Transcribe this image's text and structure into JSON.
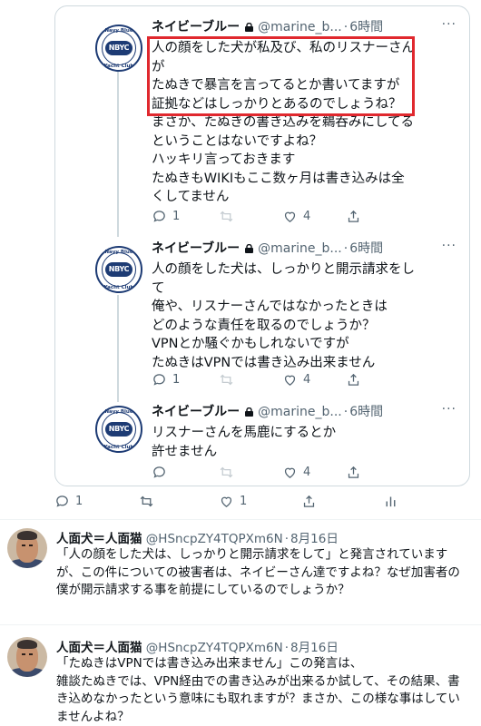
{
  "quoted_tweets": [
    {
      "display_name": "ネイビーブルー",
      "handle": "@marine_b...",
      "time": "6時間",
      "logo": {
        "top_text": "Navy Blue",
        "center_text": "NBYC",
        "bottom_text": "Yacht Club"
      },
      "lines": [
        "人の顔をした犬が私及び、私のリスナーさん",
        "が",
        "たぬきで暴言を言ってるとか書いてますが",
        "証拠などはしっかりとあるのでしょうね？",
        "まさか、たぬきの書き込みを鵜呑みにしてる",
        "ということはないですよね？",
        "ハッキリ言っておきます",
        "たぬきもWIKIもここ数ヶ月は書き込みは全",
        "くしてません"
      ],
      "reply_count": "1",
      "like_count": "4"
    },
    {
      "display_name": "ネイビーブルー",
      "handle": "@marine_b...",
      "time": "6時間",
      "logo": {
        "top_text": "Navy Blue",
        "center_text": "NBYC",
        "bottom_text": "Yacht Club"
      },
      "lines": [
        "人の顔をした犬は、しっかりと開示請求をし",
        "て",
        "俺や、リスナーさんではなかったときは",
        "どのような責任を取るのでしょうか？",
        "VPNとか騒ぐかもしれないですが",
        "たぬきはVPNでは書き込み出来ません"
      ],
      "reply_count": "1",
      "like_count": "4"
    },
    {
      "display_name": "ネイビーブルー",
      "handle": "@marine_b...",
      "time": "6時間",
      "logo": {
        "top_text": "Navy Blue",
        "center_text": "NBYC",
        "bottom_text": "Yacht Club"
      },
      "lines": [
        "リスナーさんを馬鹿にするとか",
        "許せません"
      ],
      "reply_count": "",
      "like_count": "4"
    }
  ],
  "outer_actions": {
    "reply_count": "1",
    "like_count": "1"
  },
  "replies": [
    {
      "display_name": "人面犬＝人面猫",
      "handle": "@HSncpZY4TQPXm6N",
      "date": "8月16日",
      "lines": [
        "「人の顔をした犬は、しっかりと開示請求をして」と発言されています",
        "が、この件についての被害者は、ネイビーさん達ですよね？なぜ加害者の",
        "僕が開示請求する事を前提にしているのでしょうか？"
      ]
    },
    {
      "display_name": "人面犬＝人面猫",
      "handle": "@HSncpZY4TQPXm6N",
      "date": "8月16日",
      "lines": [
        "「たぬきはVPNでは書き込み出来ません」この発言は、",
        "雑談たぬきでは、VPN経由での書き込みが出来るか試して、その結果、書",
        "き込めなかったという意味にも取れますが？まさか、この様な事はしてい",
        "ませんよね？"
      ]
    }
  ],
  "colors": {
    "highlight": "#e0282e",
    "muted": "#536471",
    "border": "#cfd9de"
  }
}
